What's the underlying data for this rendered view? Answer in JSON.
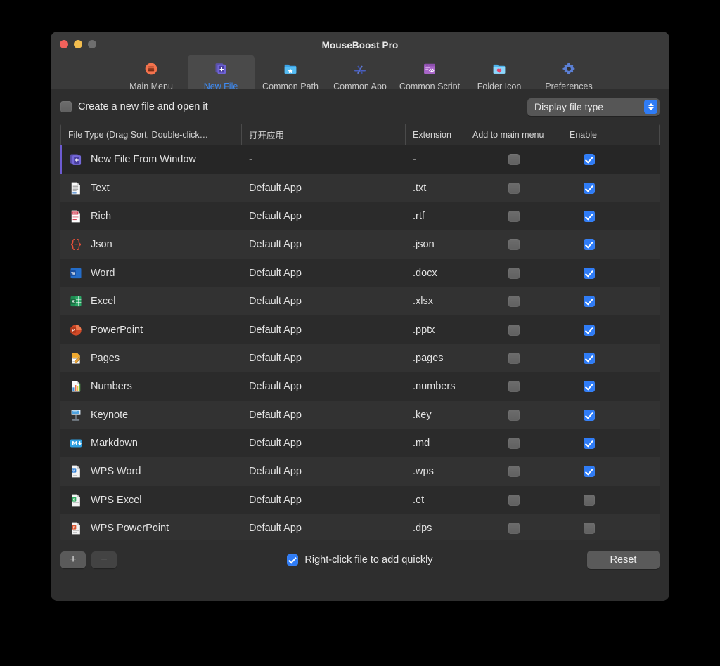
{
  "window": {
    "title": "MouseBoost Pro",
    "traffic_lights": [
      {
        "name": "close",
        "color": "#f1615b"
      },
      {
        "name": "minimize",
        "color": "#f3bd4e"
      },
      {
        "name": "zoom",
        "color": "#6e6e6e"
      }
    ]
  },
  "toolbar": {
    "active_index": 1,
    "active_color": "#3d8bf5",
    "items": [
      {
        "label": "Main Menu",
        "icon": "hamburger-circle-icon"
      },
      {
        "label": "New File",
        "icon": "new-file-plus-icon"
      },
      {
        "label": "Common Path",
        "icon": "folder-star-icon"
      },
      {
        "label": "Common App",
        "icon": "app-store-icon"
      },
      {
        "label": "Common Script",
        "icon": "script-code-window-icon"
      },
      {
        "label": "Folder Icon",
        "icon": "folder-heart-icon"
      },
      {
        "label": "Preferences",
        "icon": "gear-icon"
      }
    ]
  },
  "options": {
    "create_and_open": {
      "label": "Create a new file and open it",
      "checked": false
    },
    "display_file_type": {
      "value": "Display file type"
    }
  },
  "table": {
    "columns": [
      {
        "key": "type",
        "label": "File Type (Drag Sort, Double-click…"
      },
      {
        "key": "app",
        "label": "打开应用"
      },
      {
        "key": "ext",
        "label": "Extension"
      },
      {
        "key": "menu",
        "label": "Add to main menu"
      },
      {
        "key": "en",
        "label": "Enable"
      }
    ],
    "rows": [
      {
        "icon": "new-file-window-icon",
        "name": "New File From Window",
        "app": "-",
        "ext": "-",
        "add_to_menu": false,
        "enable": true,
        "selected": true
      },
      {
        "icon": "text-file-icon",
        "name": "Text",
        "app": "Default App",
        "ext": ".txt",
        "add_to_menu": false,
        "enable": true,
        "selected": false
      },
      {
        "icon": "rtf-file-icon",
        "name": "Rich",
        "app": "Default App",
        "ext": ".rtf",
        "add_to_menu": false,
        "enable": true,
        "selected": false
      },
      {
        "icon": "json-braces-icon",
        "name": "Json",
        "app": "Default App",
        "ext": ".json",
        "add_to_menu": false,
        "enable": true,
        "selected": false
      },
      {
        "icon": "word-icon",
        "name": "Word",
        "app": "Default App",
        "ext": ".docx",
        "add_to_menu": false,
        "enable": true,
        "selected": false
      },
      {
        "icon": "excel-icon",
        "name": "Excel",
        "app": "Default App",
        "ext": ".xlsx",
        "add_to_menu": false,
        "enable": true,
        "selected": false
      },
      {
        "icon": "powerpoint-icon",
        "name": "PowerPoint",
        "app": "Default App",
        "ext": ".pptx",
        "add_to_menu": false,
        "enable": true,
        "selected": false
      },
      {
        "icon": "pages-icon",
        "name": "Pages",
        "app": "Default App",
        "ext": ".pages",
        "add_to_menu": false,
        "enable": true,
        "selected": false
      },
      {
        "icon": "numbers-icon",
        "name": "Numbers",
        "app": "Default App",
        "ext": ".numbers",
        "add_to_menu": false,
        "enable": true,
        "selected": false
      },
      {
        "icon": "keynote-icon",
        "name": "Keynote",
        "app": "Default App",
        "ext": ".key",
        "add_to_menu": false,
        "enable": true,
        "selected": false
      },
      {
        "icon": "markdown-icon",
        "name": "Markdown",
        "app": "Default App",
        "ext": ".md",
        "add_to_menu": false,
        "enable": true,
        "selected": false
      },
      {
        "icon": "wps-word-icon",
        "name": "WPS Word",
        "app": "Default App",
        "ext": ".wps",
        "add_to_menu": false,
        "enable": true,
        "selected": false
      },
      {
        "icon": "wps-excel-icon",
        "name": "WPS Excel",
        "app": "Default App",
        "ext": ".et",
        "add_to_menu": false,
        "enable": false,
        "selected": false
      },
      {
        "icon": "wps-powerpoint-icon",
        "name": "WPS PowerPoint",
        "app": "Default App",
        "ext": ".dps",
        "add_to_menu": false,
        "enable": false,
        "selected": false
      }
    ]
  },
  "footer": {
    "add_label": "+",
    "remove_label": "−",
    "right_click_add": {
      "label": "Right-click file to add quickly",
      "checked": true
    },
    "reset_label": "Reset"
  }
}
